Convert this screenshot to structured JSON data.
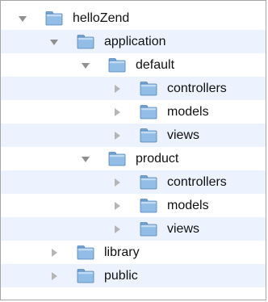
{
  "tree": {
    "colors": {
      "alt_row": "#edf3fe",
      "arrow": "#8f8f8f",
      "folder_body": "#92bde6",
      "folder_tab": "#7aa8d6",
      "folder_edge": "#4f82b8",
      "text": "#111111"
    },
    "items": [
      {
        "label": "helloZend",
        "level": 0,
        "expanded": true,
        "icon": "folder-icon"
      },
      {
        "label": "application",
        "level": 1,
        "expanded": true,
        "icon": "folder-icon"
      },
      {
        "label": "default",
        "level": 2,
        "expanded": true,
        "icon": "folder-icon"
      },
      {
        "label": "controllers",
        "level": 3,
        "expanded": false,
        "icon": "folder-icon"
      },
      {
        "label": "models",
        "level": 3,
        "expanded": false,
        "icon": "folder-icon"
      },
      {
        "label": "views",
        "level": 3,
        "expanded": false,
        "icon": "folder-icon"
      },
      {
        "label": "product",
        "level": 2,
        "expanded": true,
        "icon": "folder-icon"
      },
      {
        "label": "controllers",
        "level": 3,
        "expanded": false,
        "icon": "folder-icon"
      },
      {
        "label": "models",
        "level": 3,
        "expanded": false,
        "icon": "folder-icon"
      },
      {
        "label": "views",
        "level": 3,
        "expanded": false,
        "icon": "folder-icon"
      },
      {
        "label": "library",
        "level": 1,
        "expanded": false,
        "icon": "folder-icon"
      },
      {
        "label": "public",
        "level": 1,
        "expanded": false,
        "icon": "folder-icon"
      }
    ]
  }
}
